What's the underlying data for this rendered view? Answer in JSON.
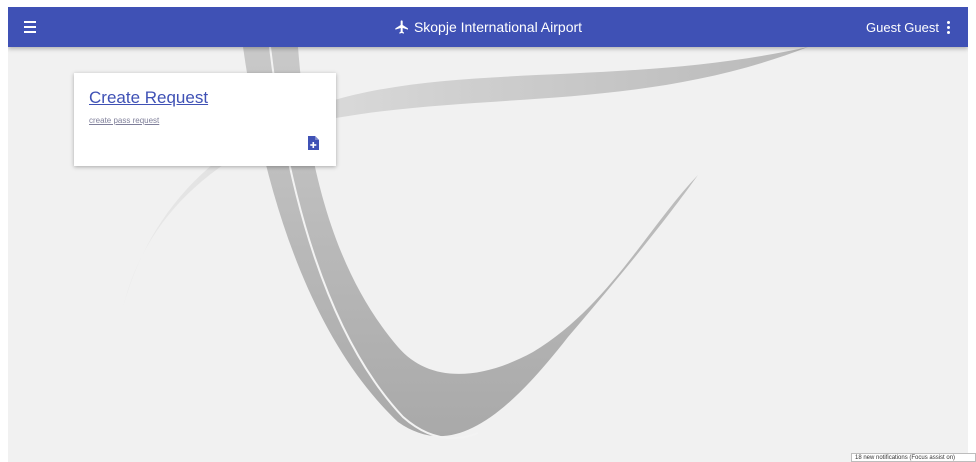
{
  "header": {
    "title": "Skopje International Airport",
    "user_name": "Guest Guest",
    "menu_icon": "hamburger-menu-icon",
    "logo_icon": "airplane-icon",
    "more_icon": "more-vert-icon",
    "bar_color": "#3f51b5"
  },
  "card": {
    "title": "Create Request",
    "subtitle": "create pass request",
    "action_icon": "add-file-icon",
    "accent_color": "#3f51b5"
  },
  "notification": {
    "text": "18 new notifications (Focus assist on)"
  }
}
